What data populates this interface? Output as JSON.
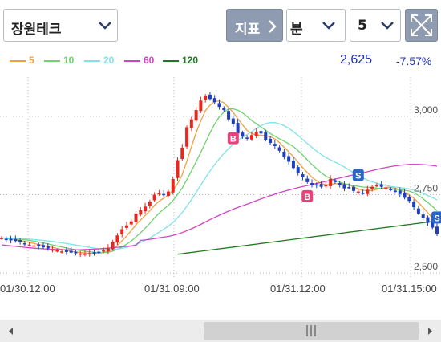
{
  "toolbar": {
    "stock_name": "장원테크",
    "indicator_label": "지표",
    "period_unit": "분",
    "period_value": "5"
  },
  "legend": {
    "items": [
      {
        "label": "5",
        "color": "#f0a040"
      },
      {
        "label": "10",
        "color": "#6ed26e"
      },
      {
        "label": "20",
        "color": "#7fe3ea"
      },
      {
        "label": "60",
        "color": "#cf45c2"
      },
      {
        "label": "120",
        "color": "#1e7a1e"
      }
    ],
    "price": "2,625",
    "change": "-7.57%"
  },
  "chart_data": {
    "type": "candlestick",
    "y_ticks": [
      "3,000",
      "2,750",
      "2,500"
    ],
    "x_ticks": [
      "01/30.12:00",
      "01/31.09:00",
      "01/31.12:00",
      "01/31.15:00"
    ],
    "ylim": [
      2485,
      3125
    ],
    "up_color": "#e8281e",
    "down_color": "#1f3fbf",
    "close": [
      2612,
      2606,
      2604,
      2602,
      2598,
      2594,
      2590,
      2588,
      2585,
      2582,
      2578,
      2575,
      2572,
      2569,
      2567,
      2565,
      2563,
      2562,
      2562,
      2563,
      2564,
      2567,
      2572,
      2580,
      2600,
      2620,
      2640,
      2652,
      2665,
      2690,
      2700,
      2712,
      2728,
      2750,
      2755,
      2750,
      2760,
      2800,
      2860,
      2900,
      2965,
      2990,
      3020,
      3050,
      3065,
      3055,
      3045,
      3030,
      3020,
      2990,
      2975,
      2945,
      2935,
      2930,
      2940,
      2950,
      2945,
      2925,
      2915,
      2905,
      2890,
      2870,
      2855,
      2835,
      2818,
      2805,
      2790,
      2780,
      2780,
      2775,
      2780,
      2800,
      2790,
      2780,
      2770,
      2772,
      2762,
      2760,
      2755,
      2766,
      2775,
      2780,
      2775,
      2772,
      2766,
      2760,
      2752,
      2740,
      2730,
      2710,
      2690,
      2675,
      2660,
      2645,
      2625
    ],
    "markers": [
      {
        "label": "B",
        "type": "buy",
        "color": "#e8427a",
        "index": 50
      },
      {
        "label": "B",
        "type": "buy",
        "color": "#e8427a",
        "index": 66
      },
      {
        "label": "S",
        "type": "sell",
        "color": "#2a66c8",
        "index": 77
      },
      {
        "label": "S",
        "type": "sell",
        "color": "#2a66c8",
        "index": 94
      }
    ],
    "ma": [
      {
        "name": "5",
        "color": "#f0a040"
      },
      {
        "name": "10",
        "color": "#6ed26e"
      },
      {
        "name": "20",
        "color": "#7fe3ea"
      },
      {
        "name": "60",
        "color": "#cf45c2"
      },
      {
        "name": "120",
        "color": "#1e7a1e"
      }
    ],
    "grid": true
  }
}
